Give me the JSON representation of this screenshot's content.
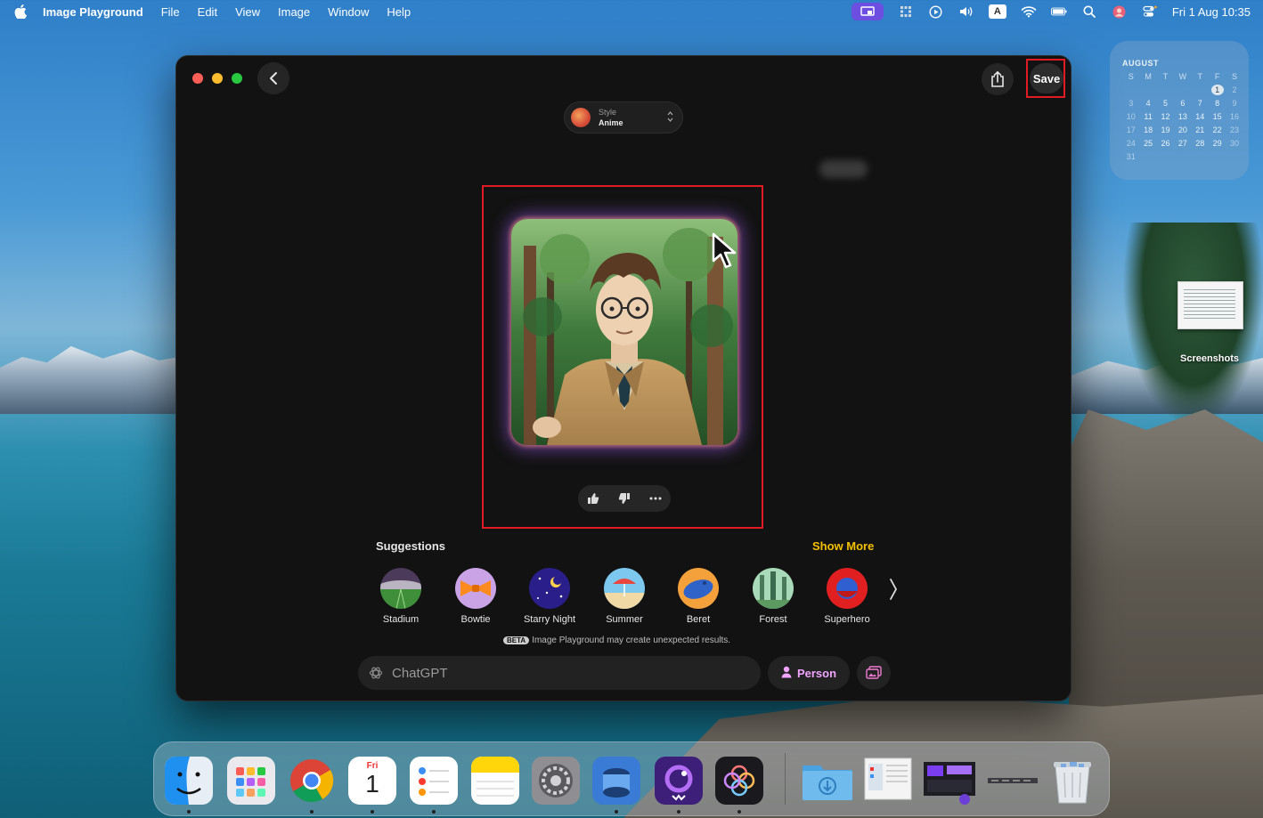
{
  "menubar": {
    "app_name": "Image Playground",
    "menus": [
      "File",
      "Edit",
      "View",
      "Image",
      "Window",
      "Help"
    ],
    "input_source": "A",
    "clock": "Fri 1 Aug 10:35"
  },
  "calendar": {
    "month": "AUGUST",
    "weekdays": [
      "S",
      "M",
      "T",
      "W",
      "T",
      "F",
      "S"
    ],
    "weeks": [
      [
        "",
        "",
        "",
        "",
        "",
        "1",
        "2"
      ],
      [
        "3",
        "4",
        "5",
        "6",
        "7",
        "8",
        "9"
      ],
      [
        "10",
        "11",
        "12",
        "13",
        "14",
        "15",
        "16"
      ],
      [
        "17",
        "18",
        "19",
        "20",
        "21",
        "22",
        "23"
      ],
      [
        "24",
        "25",
        "26",
        "27",
        "28",
        "29",
        "30"
      ],
      [
        "31",
        "",
        "",
        "",
        "",
        "",
        ""
      ]
    ],
    "today": "1"
  },
  "desktop": {
    "screenshots_label": "Screenshots"
  },
  "window": {
    "save_label": "Save",
    "style": {
      "label": "Style",
      "value": "Anime"
    },
    "suggestions_title": "Suggestions",
    "show_more": "Show More",
    "suggestions": [
      {
        "label": "Stadium",
        "icon": "stadium-icon"
      },
      {
        "label": "Bowtie",
        "icon": "bowtie-icon"
      },
      {
        "label": "Starry Night",
        "icon": "starry-night-icon"
      },
      {
        "label": "Summer",
        "icon": "summer-icon"
      },
      {
        "label": "Beret",
        "icon": "beret-icon"
      },
      {
        "label": "Forest",
        "icon": "forest-icon"
      },
      {
        "label": "Superhero",
        "icon": "superhero-icon"
      }
    ],
    "beta_badge": "BETA",
    "beta_note": "Image Playground may create unexpected results.",
    "prompt_placeholder": "ChatGPT",
    "person_label": "Person"
  },
  "dock": {
    "calendar_day": "Fri",
    "calendar_date": "1",
    "apps": [
      "finder",
      "launchpad",
      "chrome",
      "calendar",
      "reminders",
      "notes",
      "system-settings",
      "preview",
      "screen-recorder",
      "image-playground"
    ]
  },
  "colors": {
    "accent_yellow": "#f5c000",
    "person_pink": "#f0a3ff",
    "highlight_red": "#e01b24",
    "window_bg": "#121212"
  }
}
